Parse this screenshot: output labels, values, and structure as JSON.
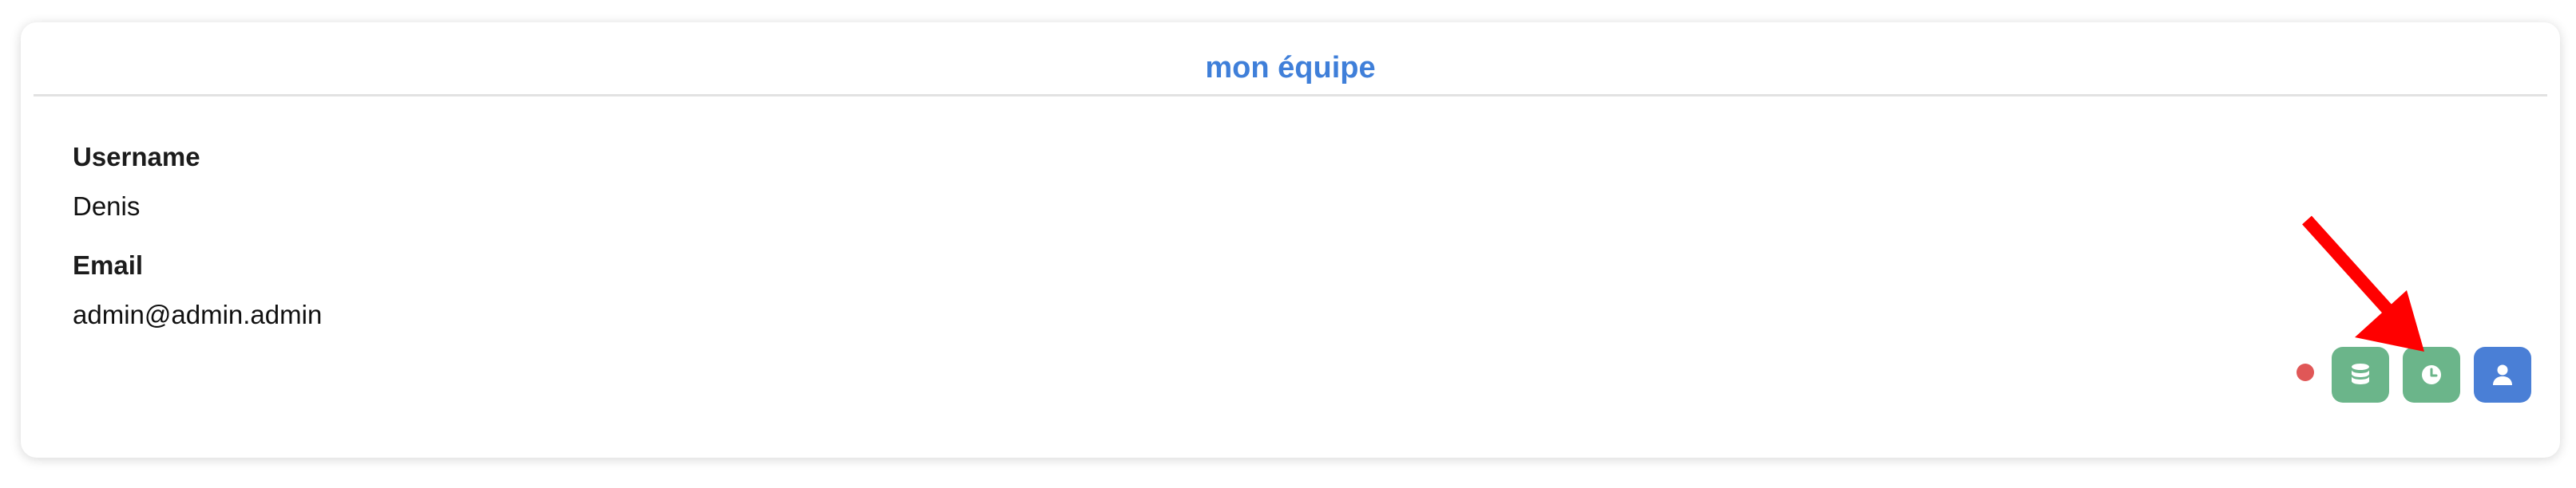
{
  "card": {
    "title": "mon équipe"
  },
  "profile": {
    "username_label": "Username",
    "username_value": "Denis",
    "email_label": "Email",
    "email_value": "admin@admin.admin"
  },
  "actions": {
    "status_dot": {
      "color": "#e05757"
    },
    "buttons": [
      {
        "icon": "database-icon",
        "color": "#6bb58a"
      },
      {
        "icon": "clock-icon",
        "color": "#6bb58a"
      },
      {
        "icon": "user-icon",
        "color": "#4a7fd6"
      }
    ]
  },
  "annotation": {
    "icon": "red-arrow-icon",
    "color": "#ff0000"
  },
  "colors": {
    "accent": "#3f7fd9",
    "green_button": "#6bb58a",
    "blue_button": "#4a7fd6",
    "status_red": "#e05757"
  }
}
